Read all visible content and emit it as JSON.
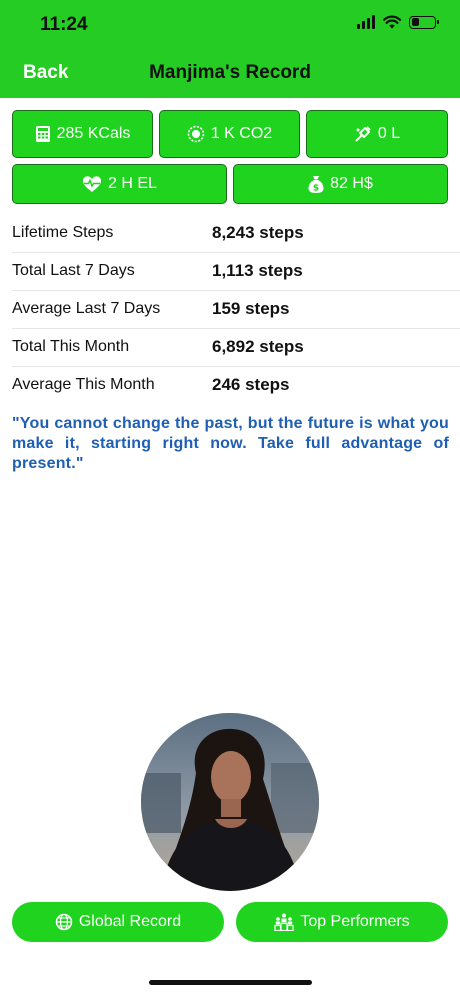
{
  "status_bar": {
    "time": "11:24",
    "battery_level": 0.35
  },
  "nav": {
    "back_label": "Back",
    "title": "Manjima's Record"
  },
  "stats": {
    "kcals": {
      "label": "285 KCals",
      "icon": "calculator-icon"
    },
    "co2": {
      "label": "1 K CO2",
      "icon": "co2-icon"
    },
    "fuel": {
      "label": "0 L",
      "icon": "fuel-nozzle-icon"
    },
    "health": {
      "label": "2 H EL",
      "icon": "heartbeat-icon"
    },
    "money": {
      "label": "82 H$",
      "icon": "money-bag-icon"
    }
  },
  "records": [
    {
      "label": "Lifetime Steps",
      "value": "8,243 steps"
    },
    {
      "label": "Total Last 7 Days",
      "value": "1,113 steps"
    },
    {
      "label": "Average Last 7 Days",
      "value": "159 steps"
    },
    {
      "label": "Total This Month",
      "value": "6,892 steps"
    },
    {
      "label": "Average This Month",
      "value": "246 steps"
    }
  ],
  "quote": "\"You cannot change the past, but the future is what you make it, starting right now. Take full advantage of present.\"",
  "buttons": {
    "global_record": "Global Record",
    "top_performers": "Top Performers"
  },
  "colors": {
    "brand_green": "#24cc24",
    "button_green": "#1fd31f",
    "quote_blue": "#1e5fb3"
  }
}
